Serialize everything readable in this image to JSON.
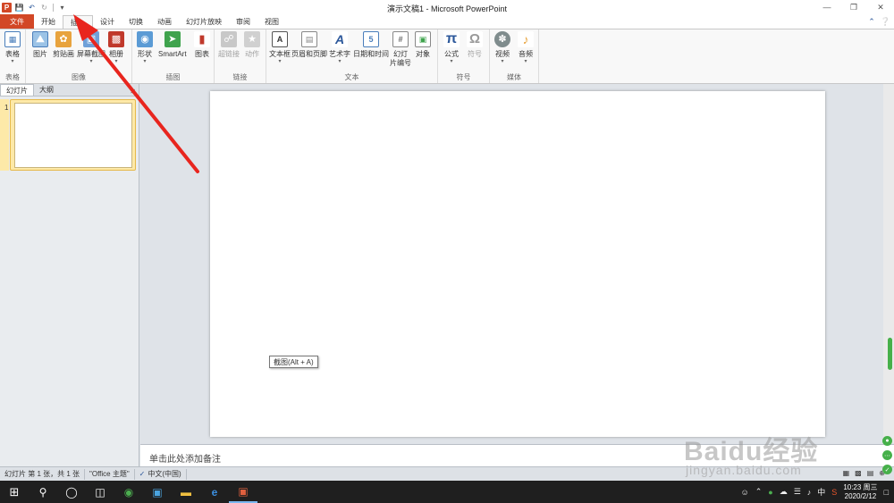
{
  "window": {
    "title": "演示文稿1 - Microsoft PowerPoint",
    "app_icon": "P"
  },
  "tabs": [
    {
      "label": "文件"
    },
    {
      "label": "开始"
    },
    {
      "label": "插入"
    },
    {
      "label": "设计"
    },
    {
      "label": "切换"
    },
    {
      "label": "动画"
    },
    {
      "label": "幻灯片放映"
    },
    {
      "label": "审阅"
    },
    {
      "label": "视图"
    }
  ],
  "ribbon": {
    "groups": {
      "tables": "表格",
      "images": "图像",
      "illustrations": "插图",
      "links": "链接",
      "text": "文本",
      "symbols": "符号",
      "media": "媒体"
    },
    "buttons": {
      "table": "表格",
      "picture": "图片",
      "clipart": "剪贴画",
      "screenshot": "屏幕截图",
      "album": "相册",
      "shapes": "形状",
      "smartart": "SmartArt",
      "chart": "图表",
      "hyperlink": "超链接",
      "action": "动作",
      "textbox": "文本框",
      "header_footer": "页眉和页脚",
      "wordart": "艺术字",
      "datetime": "日期和时间",
      "slide_number_1": "幻灯",
      "slide_number_2": "片编号",
      "object": "对象",
      "equation": "公式",
      "symbol": "符号",
      "video": "视频",
      "audio": "音频"
    }
  },
  "panel": {
    "tab_slides": "幻灯片",
    "tab_outline": "大纲",
    "slide_number": "1"
  },
  "tooltip": "截图(Alt + A)",
  "notes": {
    "placeholder": "单击此处添加备注"
  },
  "status": {
    "slide_info": "幻灯片 第 1 张，共 1 张",
    "theme": "\"Office 主题\"",
    "language": "中文(中国)"
  },
  "taskbar": {
    "time": "10:23 周三",
    "date": "2020/2/12",
    "ime": "中"
  },
  "watermark": {
    "line1": "Baidu经验",
    "line2": "jingyan.baidu.com"
  },
  "colors": {
    "file_tab": "#d24726",
    "annotation_arrow": "#e8251e",
    "thumb_highlight": "#fde9a8"
  }
}
